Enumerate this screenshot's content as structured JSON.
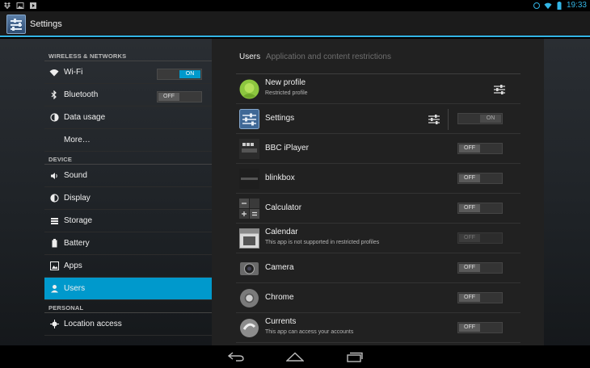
{
  "status_bar": {
    "time": "19:33"
  },
  "action_bar": {
    "title": "Settings"
  },
  "left_panel": {
    "wireless_header": "WIRELESS & NETWORKS",
    "wifi": {
      "label": "Wi-Fi",
      "toggle": "ON"
    },
    "bluetooth": {
      "label": "Bluetooth",
      "toggle": "OFF"
    },
    "data_usage": {
      "label": "Data usage"
    },
    "more": {
      "label": "More…"
    },
    "device_header": "DEVICE",
    "sound": {
      "label": "Sound"
    },
    "display": {
      "label": "Display"
    },
    "storage": {
      "label": "Storage"
    },
    "battery": {
      "label": "Battery"
    },
    "apps": {
      "label": "Apps"
    },
    "users": {
      "label": "Users"
    },
    "personal_header": "PERSONAL",
    "location": {
      "label": "Location access"
    }
  },
  "right_panel": {
    "tab_users": "Users",
    "tab_restrictions": "Application and content restrictions",
    "rows": [
      {
        "name": "New profile",
        "sub": "Restricted profile",
        "icon": "android-avatar-icon"
      },
      {
        "name": "Settings",
        "toggle": "ON",
        "icon": "settings-app-icon"
      },
      {
        "name": "BBC iPlayer",
        "toggle": "OFF",
        "icon": "bbc-iplayer-icon"
      },
      {
        "name": "blinkbox",
        "toggle": "OFF",
        "icon": "blinkbox-icon"
      },
      {
        "name": "Calculator",
        "toggle": "OFF",
        "icon": "calculator-icon"
      },
      {
        "name": "Calendar",
        "sub": "This app is not supported in restricted profiles",
        "toggle": "OFF",
        "icon": "calendar-icon"
      },
      {
        "name": "Camera",
        "toggle": "OFF",
        "icon": "camera-icon"
      },
      {
        "name": "Chrome",
        "toggle": "OFF",
        "icon": "chrome-icon"
      },
      {
        "name": "Currents",
        "sub": "This app can access your accounts",
        "toggle": "OFF",
        "icon": "currents-icon"
      }
    ]
  },
  "colors": {
    "accent": "#33b5e5",
    "selected": "#0099cc"
  }
}
